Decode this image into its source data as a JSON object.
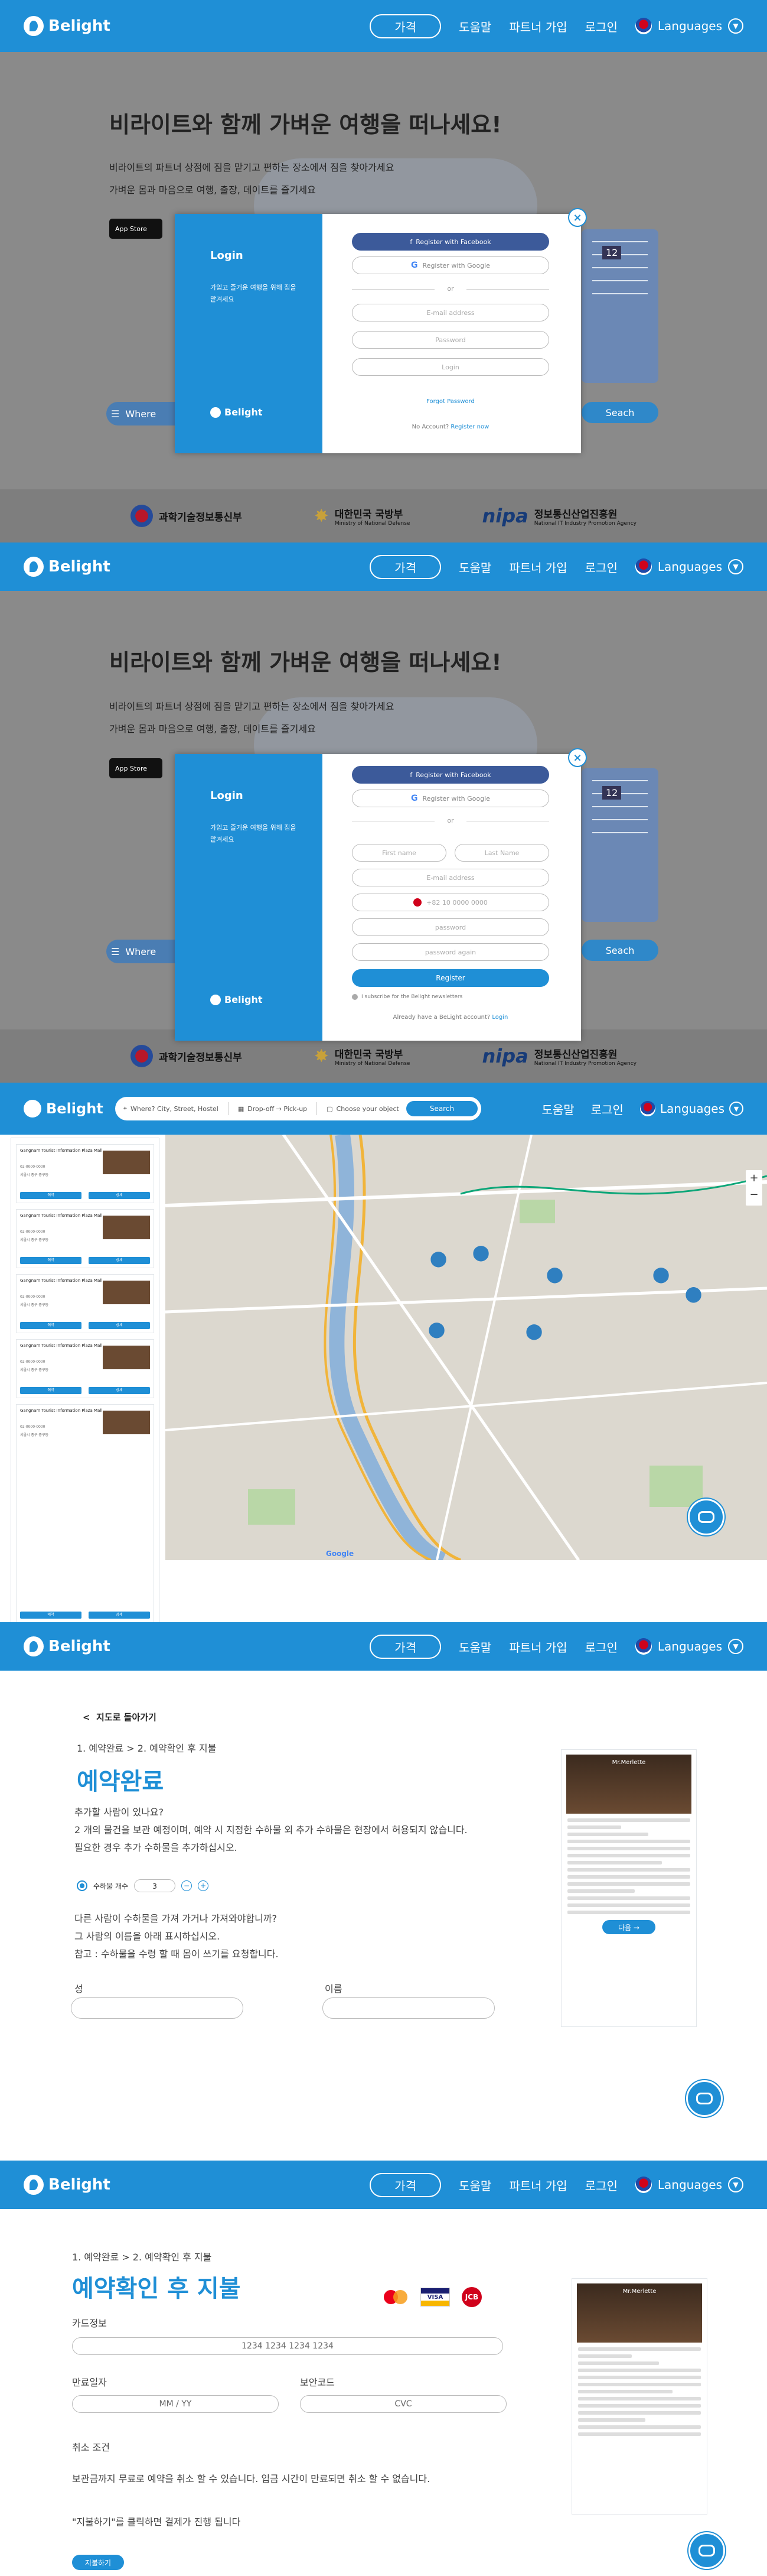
{
  "brand": {
    "name": "Belight",
    "primary": "#1f8fd6",
    "overlay": "#8a8a8a"
  },
  "nav": {
    "price": "가격",
    "help": "도움말",
    "partner": "파트너 가입",
    "login": "로그인",
    "languages": "Languages"
  },
  "hero": {
    "title": "비라이트와 함께 가벼운 여행을 떠나세요!",
    "line1": "비라이트의 파트너 상점에 짐을 맡기고 편하는 장소에서 짐을 찾아가세요",
    "line2": "가벼운 몸과 마음으로 여행, 출장, 데이트를 즐기세요",
    "appstore": "App Store",
    "where": "Where",
    "date_num": "12",
    "search": "Seach"
  },
  "footer": {
    "msit": "과학기술정보통신부",
    "mnd": "대한민국 국방부",
    "mnd_en": "Ministry of National Defense",
    "nipa": "nipa",
    "nipa_kr": "정보통신산업진흥원",
    "nipa_en": "National IT Industry Promotion Agency"
  },
  "login_modal": {
    "title": "Login",
    "desc": "가입고 즐거운 여행을 위해 짐을 맡겨세요",
    "facebook": "Register with Facebook",
    "google": "Register with Google",
    "or": "or",
    "email": "E-mail address",
    "password": "Password",
    "login_btn": "Login",
    "forgot": "Forgot Password",
    "no_account": "No Account?",
    "register_now": "Register now",
    "close": "×"
  },
  "register_modal": {
    "title": "Login",
    "desc": "가입고 즐거운 여행을 위해 짐을 맡겨세요",
    "facebook": "Register with Facebook",
    "google": "Register with Google",
    "or": "or",
    "first_name": "First name",
    "last_name": "Last Name",
    "email": "E-mail address",
    "phone": "+82 10 0000 0000",
    "password": "password",
    "password_again": "password again",
    "register_btn": "Register",
    "subscribe": "I subscribe for the Belight newsletters",
    "already": "Already have a BeLight account?",
    "login_link": "Login",
    "close": "×"
  },
  "map_header": {
    "where": "Where? City, Street, Hostel",
    "dates": "Drop-off → Pick-up",
    "object": "Choose your object",
    "search": "Search"
  },
  "map_list": {
    "items": [
      {
        "title": "Gangnam Tourist Information Plaza Mall",
        "line1": "02-0000-0000",
        "line2": "서울시 종구 중구동"
      },
      {
        "title": "Gangnam Tourist Information Plaza Mall",
        "line1": "02-0000-0000",
        "line2": "서울시 종구 중구동"
      },
      {
        "title": "Gangnam Tourist Information Plaza Mall",
        "line1": "02-0000-0000",
        "line2": "서울시 종구 중구동"
      },
      {
        "title": "Gangnam Tourist Information Plaza Mall",
        "line1": "02-0000-0000",
        "line2": "서울시 종구 중구동"
      },
      {
        "title": "Gangnam Tourist Information Plaza Mall",
        "line1": "02-0000-0000",
        "line2": "서울시 종구 중구동"
      }
    ],
    "btn_left": "예약",
    "btn_right": "상세",
    "map_attr": "Google"
  },
  "complete": {
    "back": "지도로 돌아가기",
    "crumbs": "1. 예약완료   >   2. 예약확인 후 지불",
    "title": "예약완료",
    "q1": "추가할 사람이 있나요?",
    "p1": "2 개의 물건을 보관 예정이며, 예약 시 지정한 수하물 외 추가 수하물은 현장에서 허용되지 않습니다.",
    "p2": "필요한 경우 추가 수하물을 추가하십시오.",
    "bag_label": "수하물 개수",
    "bag_value": "3",
    "q2": "다른 사람이 수하물을 가져 가거나 가져와야합니까?",
    "p3": "그 사람의 이름을 아래 표시하십시오.",
    "p4": "참고 : 수하물을 수령 할 때 몸이 쓰기를 요청합니다.",
    "surname": "성",
    "name": "이름",
    "next": "다음 →"
  },
  "payment": {
    "crumbs": "1. 예약완료   >   2. 예약확인 후 지불",
    "title": "예약확인 후 지불",
    "card_info": "카드정보",
    "card_number": "1234  1234  1234  1234",
    "expiry_label": "만료일자",
    "expiry_ph": "MM / YY",
    "cvc_label": "보안코드",
    "cvc_ph": "CVC",
    "cancel_label": "취소 조건",
    "cancel_text": "보관금까지 무료로 예약을 취소 할 수 있습니다. 입금 시간이 만료되면 취소 할 수 없습니다.",
    "notice": "\"지불하기\"를 클릭하면 결제가 진행 됩니다",
    "pay_btn": "지불하기",
    "visa": "VISA",
    "jcb": "JCB"
  },
  "sidecard": {
    "shop": "Mr.Merlette",
    "next": "다음 →"
  }
}
